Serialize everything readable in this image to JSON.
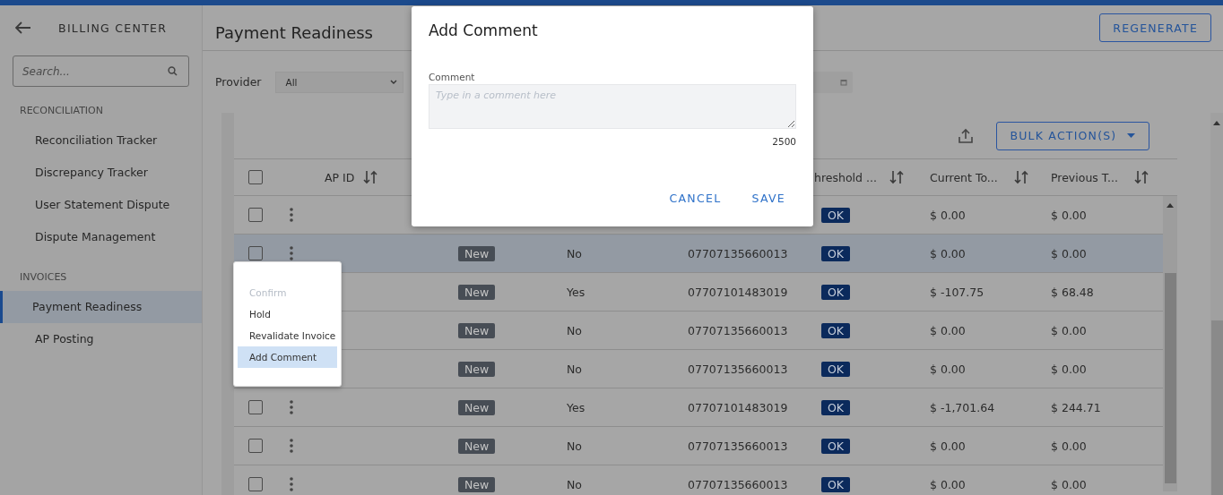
{
  "sidebar": {
    "title": "BILLING CENTER",
    "search": {
      "placeholder": "Search..."
    },
    "sections": [
      {
        "heading": "RECONCILIATION",
        "items": [
          {
            "label": "Reconciliation Tracker",
            "selected": false
          },
          {
            "label": "Discrepancy Tracker",
            "selected": false
          },
          {
            "label": "User Statement Dispute",
            "selected": false
          },
          {
            "label": "Dispute Management",
            "selected": false
          }
        ]
      },
      {
        "heading": "INVOICES",
        "items": [
          {
            "label": "Payment Readiness",
            "selected": true
          },
          {
            "label": "AP Posting",
            "selected": false
          }
        ]
      }
    ]
  },
  "page": {
    "title": "Payment Readiness",
    "regenerate_button": "REGENERATE"
  },
  "filters": {
    "provider": {
      "label": "Provider",
      "value": "All"
    }
  },
  "toolbar": {
    "bulk_button": "BULK ACTION(S)"
  },
  "table": {
    "header_checked": false,
    "columns": [
      {
        "label": "AP ID"
      },
      {},
      {},
      {},
      {
        "label": "hreshold ..."
      },
      {
        "label": "Current To..."
      },
      {
        "label": "Previous T..."
      }
    ],
    "rows": [
      {
        "checked": false,
        "selected": false,
        "threshold": "OK",
        "current": "$ 0.00",
        "previous": "$ 0.00"
      },
      {
        "checked": false,
        "selected": true,
        "status": "New",
        "flag": "No",
        "account": "07707135660013",
        "threshold": "OK",
        "current": "$ 0.00",
        "previous": "$ 0.00"
      },
      {
        "selected": false,
        "status": "New",
        "flag": "Yes",
        "account": "07707101483019",
        "threshold": "OK",
        "current": "$ -107.75",
        "previous": "$ 68.48"
      },
      {
        "selected": false,
        "status": "New",
        "flag": "No",
        "account": "07707135660013",
        "threshold": "OK",
        "current": "$ 0.00",
        "previous": "$ 0.00"
      },
      {
        "selected": false,
        "status": "New",
        "flag": "No",
        "account": "07707135660013",
        "threshold": "OK",
        "current": "$ 0.00",
        "previous": "$ 0.00"
      },
      {
        "checked": false,
        "selected": false,
        "status": "New",
        "flag": "Yes",
        "account": "07707101483019",
        "threshold": "OK",
        "current": "$ -1,701.64",
        "previous": "$ 244.71"
      },
      {
        "checked": false,
        "selected": false,
        "status": "New",
        "flag": "No",
        "account": "07707135660013",
        "threshold": "OK",
        "current": "$ 0.00",
        "previous": "$ 0.00"
      },
      {
        "checked": false,
        "selected": false,
        "status": "New",
        "flag": "No",
        "account": "07707135660013",
        "threshold": "OK",
        "current": "$ 0.00",
        "previous": "$ 0.00"
      }
    ]
  },
  "row_menu": {
    "items": [
      {
        "label": "Confirm",
        "disabled": true,
        "selected": false
      },
      {
        "label": "Hold",
        "disabled": false,
        "selected": false
      },
      {
        "label": "Revalidate Invoice",
        "disabled": false,
        "selected": false
      },
      {
        "label": "Add Comment",
        "disabled": false,
        "selected": true
      }
    ]
  },
  "dialog": {
    "title": "Add Comment",
    "field_label": "Comment",
    "placeholder": "Type in a comment here",
    "counter": "2500",
    "cancel": "CANCEL",
    "save": "SAVE"
  }
}
